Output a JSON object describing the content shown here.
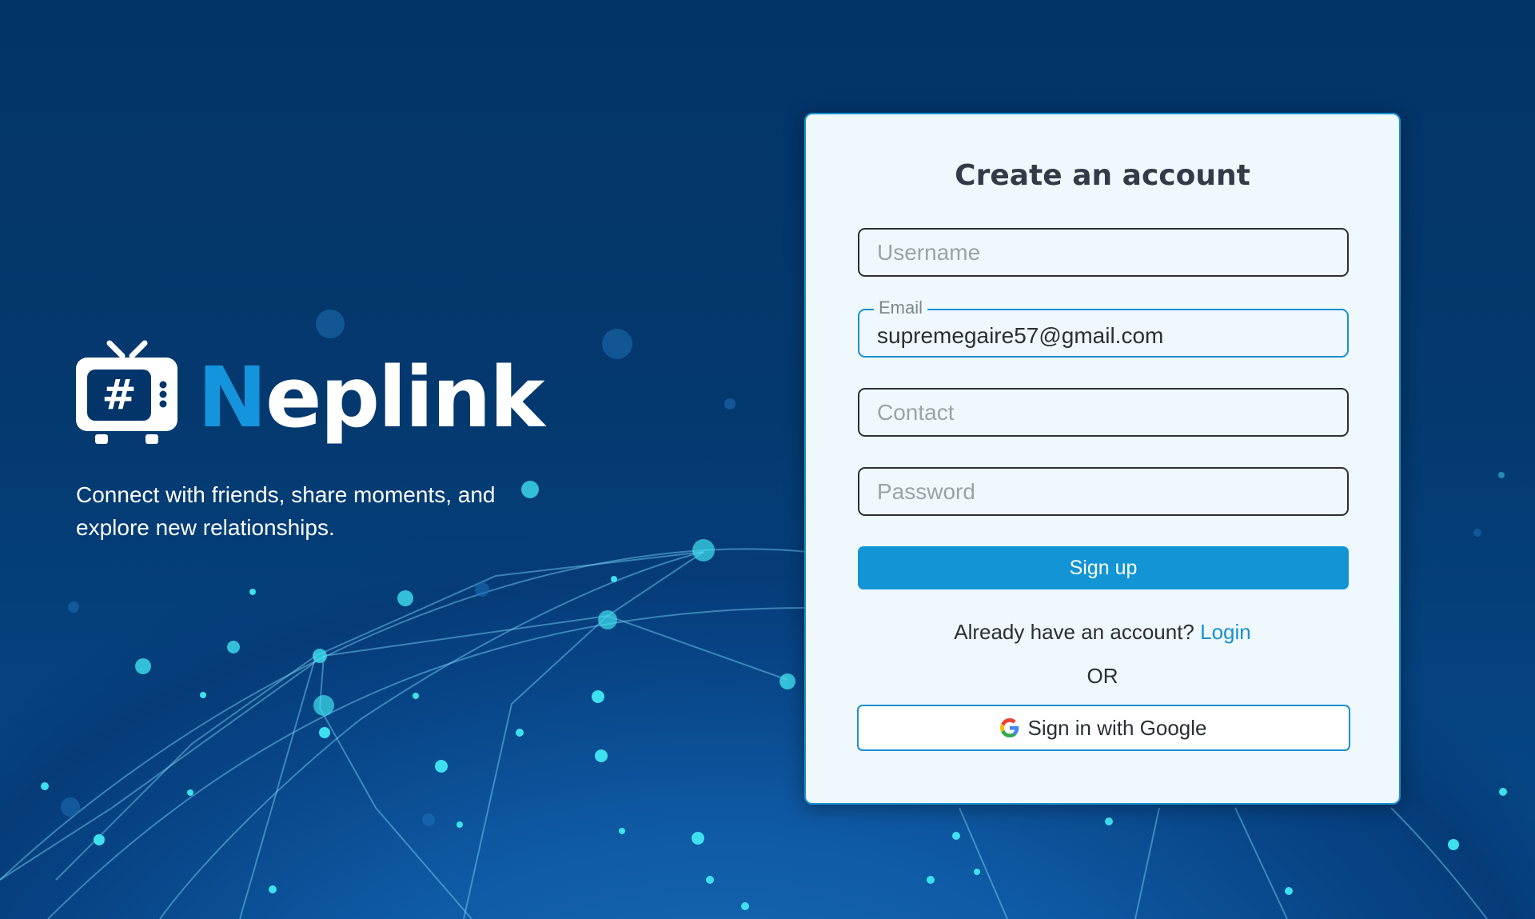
{
  "brand": {
    "name_part1": "N",
    "name_part2": "ep",
    "name_part3": "link",
    "tagline": "Connect with friends, share moments, and explore new relationships."
  },
  "form": {
    "title": "Create an account",
    "username": {
      "placeholder": "Username",
      "value": ""
    },
    "email": {
      "label": "Email",
      "value": "supremegaire57@gmail.com"
    },
    "contact": {
      "placeholder": "Contact",
      "value": ""
    },
    "password": {
      "placeholder": "Password",
      "value": ""
    },
    "signup_label": "Sign up",
    "login_prompt": "Already have an account?",
    "login_link": "Login",
    "or_text": "OR",
    "google_label": "Sign in with Google"
  },
  "colors": {
    "accent": "#1394d4",
    "background": "#03356a",
    "card": "#eef8fd"
  },
  "icons": [
    "tv-logo-icon",
    "google-icon"
  ]
}
